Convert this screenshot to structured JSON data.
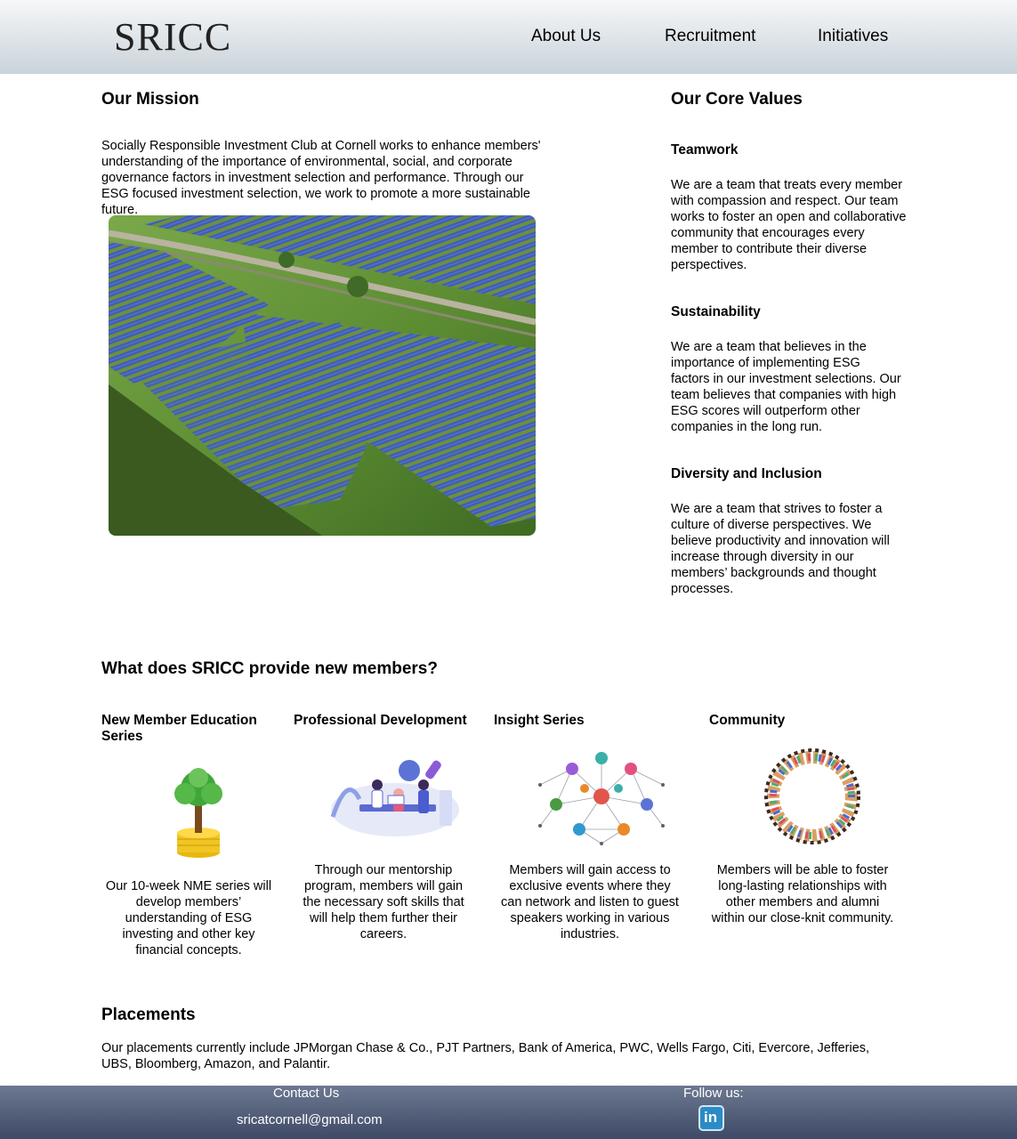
{
  "header": {
    "logo": "SRICC",
    "nav": {
      "about": "About Us",
      "recruitment": "Recruitment",
      "initiatives": "Initiatives"
    }
  },
  "mission": {
    "title": "Our Mission",
    "text": "Socially Responsible Investment Club at Cornell works to enhance members' understanding of the importance of environmental, social, and corporate governance factors in investment selection and performance. Through our ESG focused investment selection, we work to promote a more sustainable future."
  },
  "values": {
    "title": "Our Core Values",
    "items": [
      {
        "title": "Teamwork",
        "text": "We are a team that treats every member with compassion and respect. Our team works to foster an open and collaborative community that encourages every member to contribute their diverse perspectives."
      },
      {
        "title": "Sustainability",
        "text": "We are a team that believes in the importance of implementing ESG factors in our investment selections. Our team believes that companies with high ESG scores will outperform other companies in the long run."
      },
      {
        "title": "Diversity and Inclusion",
        "text": "We are a team that strives to foster a culture of diverse perspectives. We believe productivity and innovation will increase through diversity in our members’ backgrounds and thought processes."
      }
    ]
  },
  "provide": {
    "title": "What does SRICC provide new members?",
    "columns": [
      {
        "title": "New Member Education Series",
        "text": "Our 10-week NME series will develop members’ understanding of ESG investing and other key financial concepts.",
        "icon": "money-tree-icon"
      },
      {
        "title": "Professional Development",
        "text": "Through our mentorship program, members will gain the necessary soft skills that will help them further their careers.",
        "icon": "team-meeting-icon"
      },
      {
        "title": "Insight Series",
        "text": "Members will gain access to exclusive events where they can network and listen to guest speakers working in various industries.",
        "icon": "network-icon"
      },
      {
        "title": "Community",
        "text": "Members will be able to foster long-lasting relationships with other members and alumni within our close-knit community.",
        "icon": "people-circle-icon"
      }
    ]
  },
  "placements": {
    "title": "Placements",
    "text": "Our placements currently include JPMorgan Chase & Co., PJT Partners, Bank of America, PWC, Wells Fargo, Citi, Evercore, Jefferies, UBS, Bloomberg, Amazon, and Palantir."
  },
  "footer": {
    "contact_label": "Contact Us",
    "email": "sricatcornell@gmail.com",
    "follow_label": "Follow us:",
    "linkedin_icon": "linkedin-icon",
    "linkedin_text": "in"
  },
  "colors": {
    "header_top": "#f6f7f8",
    "header_bottom": "#c9d3da",
    "footer": "#4a5672",
    "linkedin": "#2b8bc6"
  }
}
